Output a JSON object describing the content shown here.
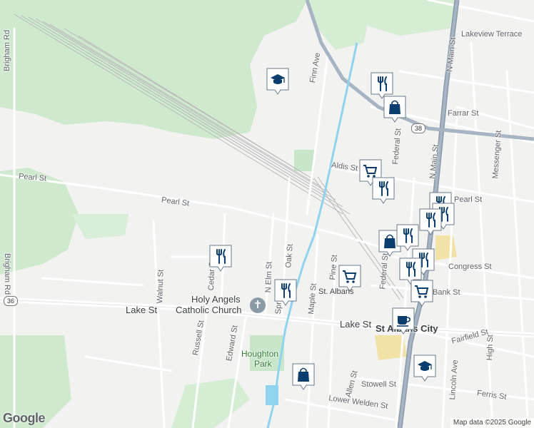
{
  "map": {
    "streets": {
      "brigham_rd_top": "Brigham Rd",
      "brigham_rd_bottom": "Brigham Rd",
      "pearl_st_west": "Pearl St",
      "pearl_st_mid": "Pearl St",
      "pearl_st_east": "Pearl St",
      "walnut_st": "Walnut St",
      "lake_st_west": "Lake St",
      "lake_st_east": "Lake St",
      "russell_st": "Russell St",
      "edward_st": "Edward St",
      "cedar_st": "Cedar St",
      "n_elm_st": "N Elm St",
      "oak_st": "Oak St",
      "spring_st": "Spring St",
      "maple_st": "Maple St",
      "pine_st": "Pine St",
      "finn_ave": "Finn Ave",
      "aldis_st": "Aldis St",
      "federal_st_north": "Federal St",
      "federal_st_south": "Federal St",
      "farrar_st": "Farrar St",
      "lakeview_terrace": "Lakeview Terrace",
      "n_main_st_top": "N Main St",
      "n_main_st_mid": "N Main St",
      "messenger_st": "Messenger St",
      "congress_st": "Congress St",
      "bank_st": "Bank St",
      "fairfield_st": "Fairfield St",
      "high_st": "High St",
      "lincoln_ave": "Lincoln Ave",
      "allen_st": "Allen St",
      "stowell_st": "Stowell St",
      "ferris_st": "Ferris St",
      "lower_welden_st": "Lower Welden St"
    },
    "places": {
      "church_line1": "Holy Angels",
      "church_line2": "Catholic Church",
      "park_line1": "Houghton",
      "park_line2": "Park",
      "st_albans": "St. Albans",
      "city": "St Albans City"
    },
    "route_shields": {
      "vt38": "38",
      "vt36": "36"
    },
    "markers": [
      {
        "type": "school-icon"
      },
      {
        "type": "restaurant-icon"
      },
      {
        "type": "shopping-bag-icon"
      },
      {
        "type": "grocery-cart-icon"
      },
      {
        "type": "restaurant-icon"
      },
      {
        "type": "restaurant-icon"
      },
      {
        "type": "restaurant-icon"
      },
      {
        "type": "restaurant-icon"
      },
      {
        "type": "shopping-bag-icon"
      },
      {
        "type": "restaurant-icon"
      },
      {
        "type": "restaurant-icon"
      },
      {
        "type": "restaurant-icon"
      },
      {
        "type": "restaurant-icon"
      },
      {
        "type": "grocery-cart-icon"
      },
      {
        "type": "restaurant-icon"
      },
      {
        "type": "grocery-cart-icon"
      },
      {
        "type": "cafe-icon"
      },
      {
        "type": "school-icon"
      },
      {
        "type": "shopping-bag-icon"
      }
    ],
    "logo": "Google",
    "attribution": "Map data ©2025 Google",
    "colors": {
      "marker_fill": "#0b3d6e",
      "park": "#c8e6c9",
      "water": "#8fd3ee",
      "highway": "#8a99ab"
    }
  }
}
